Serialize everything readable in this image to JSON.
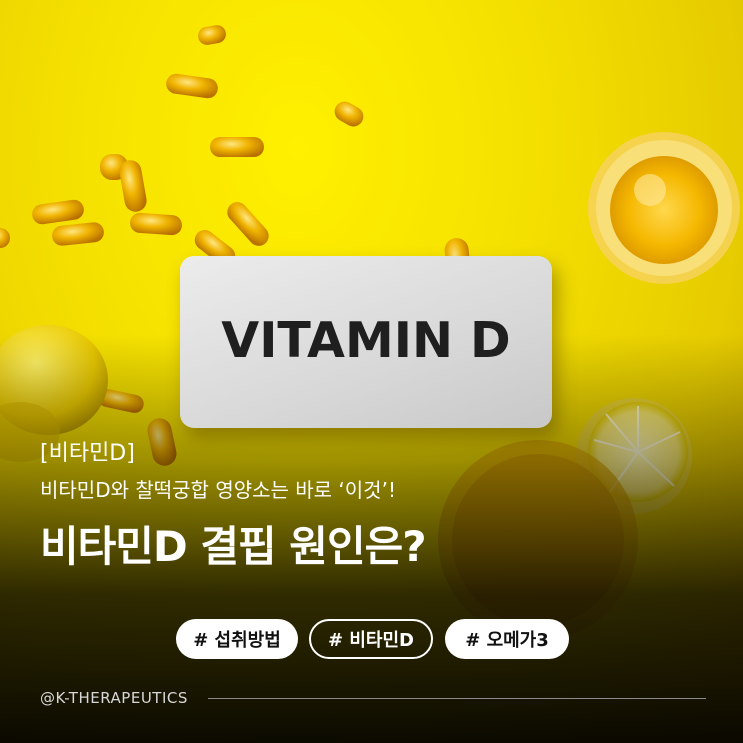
{
  "sign": {
    "text": "VITAMIN D"
  },
  "header": {
    "category": "[비타민D]",
    "subtitle": "비타민D와 찰떡궁합 영양소는 바로 ‘이것’!",
    "title": "비타민D 결핍 원인은?"
  },
  "tags": [
    {
      "label": "# 섭취방법",
      "style": "filled"
    },
    {
      "label": "# 비타민D",
      "style": "outlined"
    },
    {
      "label": "# 오메가3",
      "style": "filled"
    }
  ],
  "footer": {
    "brand": "@K-THERAPEUTICS"
  },
  "colors": {
    "background": "#f5e100",
    "capsule": "#e8a200",
    "lemon": "#f2d600"
  }
}
